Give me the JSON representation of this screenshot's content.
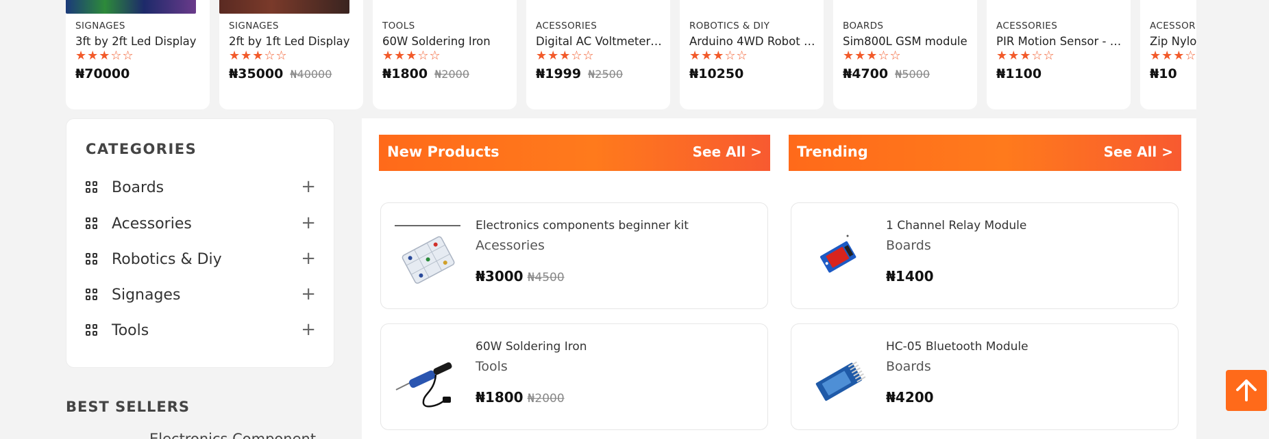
{
  "carousel": [
    {
      "category": "SIGNAGES",
      "title": "3ft by 2ft Led Display",
      "stars": "★★★☆☆",
      "price": "₦70000",
      "old_price": "",
      "thumb_color": "#1d2a4a"
    },
    {
      "category": "SIGNAGES",
      "title": "2ft by 1ft Led Display",
      "stars": "★★★☆☆",
      "price": "₦35000",
      "old_price": "₦40000",
      "thumb_color": "#4a2a26"
    },
    {
      "category": "TOOLS",
      "title": "60W Soldering Iron",
      "stars": "★★★☆☆",
      "price": "₦1800",
      "old_price": "₦2000",
      "thumb_color": "#ffffff"
    },
    {
      "category": "ACESSORIES",
      "title": "Digital AC Voltmeter…",
      "stars": "★★★☆☆",
      "price": "₦1999",
      "old_price": "₦2500",
      "thumb_color": "#ffffff"
    },
    {
      "category": "ROBOTICS & DIY",
      "title": "Arduino 4WD Robot …",
      "stars": "★★★☆☆",
      "price": "₦10250",
      "old_price": "",
      "thumb_color": "#ffffff"
    },
    {
      "category": "BOARDS",
      "title": "Sim800L GSM module",
      "stars": "★★★☆☆",
      "price": "₦4700",
      "old_price": "₦5000",
      "thumb_color": "#ffffff"
    },
    {
      "category": "ACESSORIES",
      "title": "PIR Motion Sensor - …",
      "stars": "★★★☆☆",
      "price": "₦1100",
      "old_price": "",
      "thumb_color": "#ffffff"
    },
    {
      "category": "ACESSOR",
      "title": "Zip Nylo",
      "stars": "★★★☆",
      "price": "₦10",
      "old_price": "",
      "thumb_color": "#ffffff"
    }
  ],
  "categories": {
    "heading": "CATEGORIES",
    "items": [
      {
        "label": "Boards",
        "expand": "+"
      },
      {
        "label": "Acessories",
        "expand": "+"
      },
      {
        "label": "Robotics & Diy",
        "expand": "+"
      },
      {
        "label": "Signages",
        "expand": "+"
      },
      {
        "label": "Tools",
        "expand": "+"
      }
    ]
  },
  "best_sellers": {
    "heading": "BEST SELLERS",
    "preview": "Electronics Component"
  },
  "new_products": {
    "title": "New Products",
    "see_all": "See All >",
    "items": [
      {
        "name": "Electronics components beginner kit",
        "category": "Acessories",
        "price": "₦3000",
        "old_price": "₦4500",
        "icon": "component-kit-icon"
      },
      {
        "name": "60W Soldering Iron",
        "category": "Tools",
        "price": "₦1800",
        "old_price": "₦2000",
        "icon": "soldering-iron-icon"
      }
    ]
  },
  "trending": {
    "title": "Trending",
    "see_all": "See All >",
    "items": [
      {
        "name": "1 Channel Relay Module",
        "category": "Boards",
        "price": "₦1400",
        "old_price": "",
        "icon": "relay-module-icon"
      },
      {
        "name": "HC-05 Bluetooth Module",
        "category": "Boards",
        "price": "₦4200",
        "old_price": "",
        "icon": "bluetooth-module-icon"
      }
    ]
  },
  "scroll_top": {
    "icon": "arrow-up-icon"
  },
  "colors": {
    "accent": "#ff6a1a",
    "star": "#f25a2a",
    "page_bg": "#f3f3f3"
  }
}
